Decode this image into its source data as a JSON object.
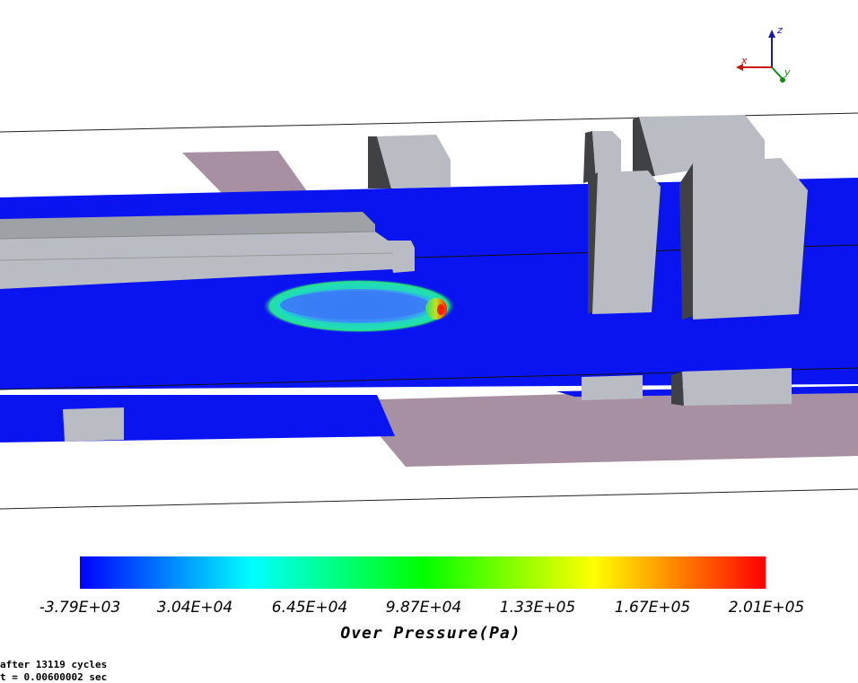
{
  "axes_triad": {
    "x_label": "x",
    "y_label": "y",
    "z_label": "z"
  },
  "colorbar": {
    "title": "Over Pressure(Pa)",
    "tick_labels": [
      "-3.79E+03",
      "3.04E+04",
      "6.45E+04",
      "9.87E+04",
      "1.33E+05",
      "1.67E+05",
      "2.01E+05"
    ],
    "colors": [
      "#0000ff",
      "#00ffff",
      "#00ff00",
      "#ffff00",
      "#ff0000"
    ]
  },
  "status": {
    "cycles_line": "after 13119 cycles",
    "time_line": "t = 0.00600002 sec"
  },
  "scene_colors": {
    "field_blue": "#0a14f0",
    "box_light": "#b9bcc2",
    "box_dark": "#3f4144",
    "ground": "#a690a2",
    "hot": "#ff2200"
  }
}
